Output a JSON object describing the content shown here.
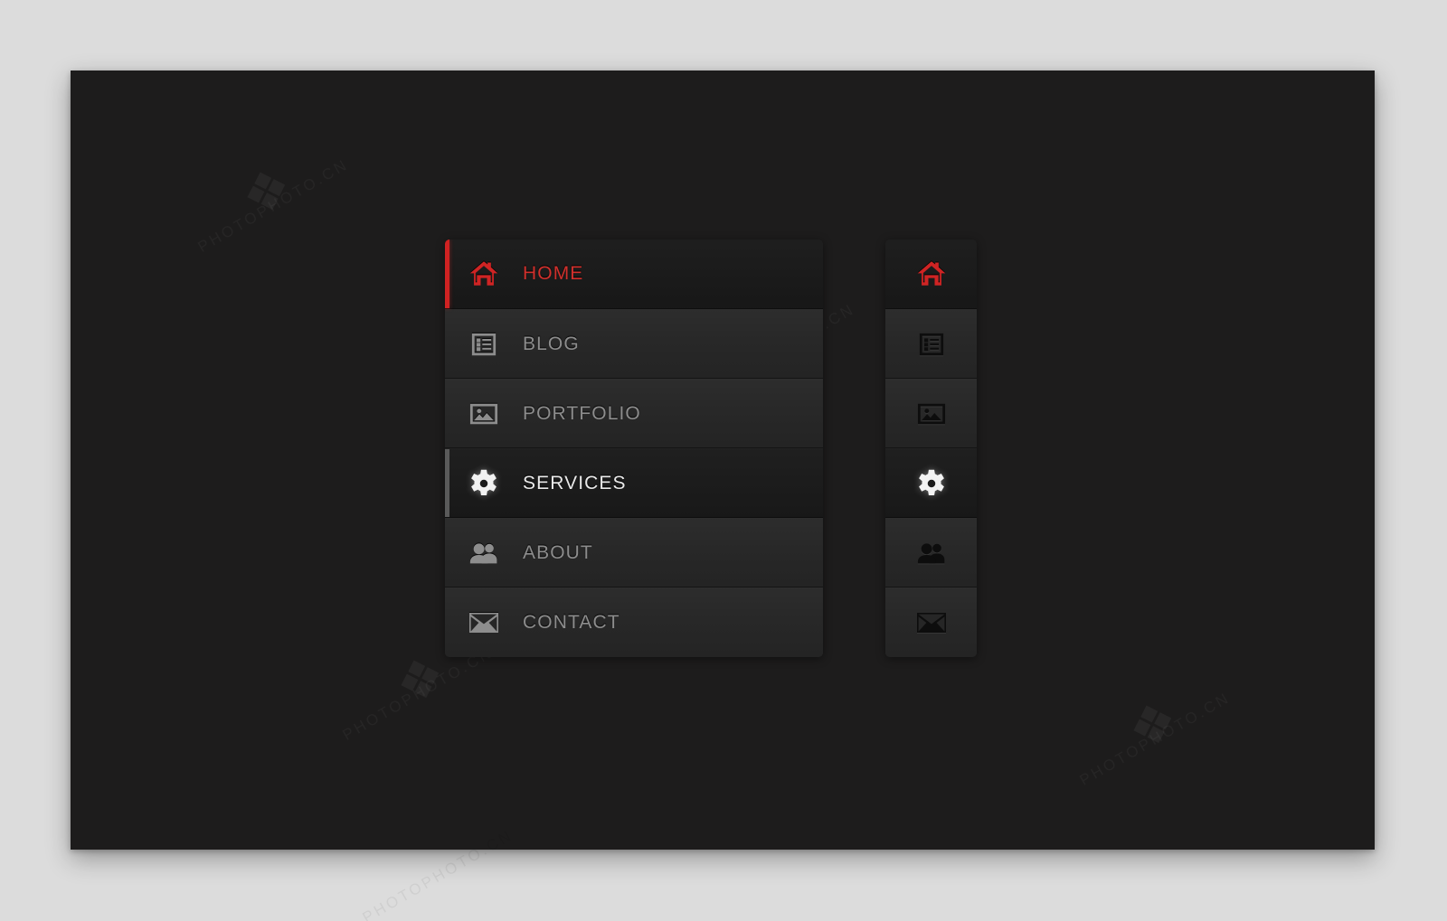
{
  "canvas": {
    "background_color": "#1d1c1c",
    "page_background_color": "#dcdcdc"
  },
  "theme": {
    "accent_red": "#cf2222",
    "active_text_red": "#d0302c",
    "current_text_white": "#eaeaea",
    "idle_text_gray": "#8d8d8d",
    "row_background": "#262626",
    "active_row_background": "#1a1a1a",
    "current_row_background": "#1b1b1b",
    "current_accent_gray": "#5a5a5a"
  },
  "menu_wide": {
    "name": "main-vertical-menu",
    "items": [
      {
        "label": "HOME",
        "icon": "home-icon",
        "state": "active"
      },
      {
        "label": "BLOG",
        "icon": "list-icon",
        "state": "idle"
      },
      {
        "label": "PORTFOLIO",
        "icon": "image-icon",
        "state": "idle"
      },
      {
        "label": "SERVICES",
        "icon": "gear-icon",
        "state": "current"
      },
      {
        "label": "ABOUT",
        "icon": "people-icon",
        "state": "idle"
      },
      {
        "label": "CONTACT",
        "icon": "envelope-icon",
        "state": "idle"
      }
    ]
  },
  "menu_narrow": {
    "name": "compact-icon-menu",
    "items": [
      {
        "label": "HOME",
        "icon": "home-icon",
        "state": "active"
      },
      {
        "label": "BLOG",
        "icon": "list-icon",
        "state": "idle"
      },
      {
        "label": "PORTFOLIO",
        "icon": "image-icon",
        "state": "idle"
      },
      {
        "label": "SERVICES",
        "icon": "gear-icon",
        "state": "current"
      },
      {
        "label": "ABOUT",
        "icon": "people-icon",
        "state": "idle"
      },
      {
        "label": "CONTACT",
        "icon": "envelope-icon",
        "state": "idle"
      }
    ]
  },
  "watermarks": {
    "text": "PHOTOPHOTO.CN"
  }
}
